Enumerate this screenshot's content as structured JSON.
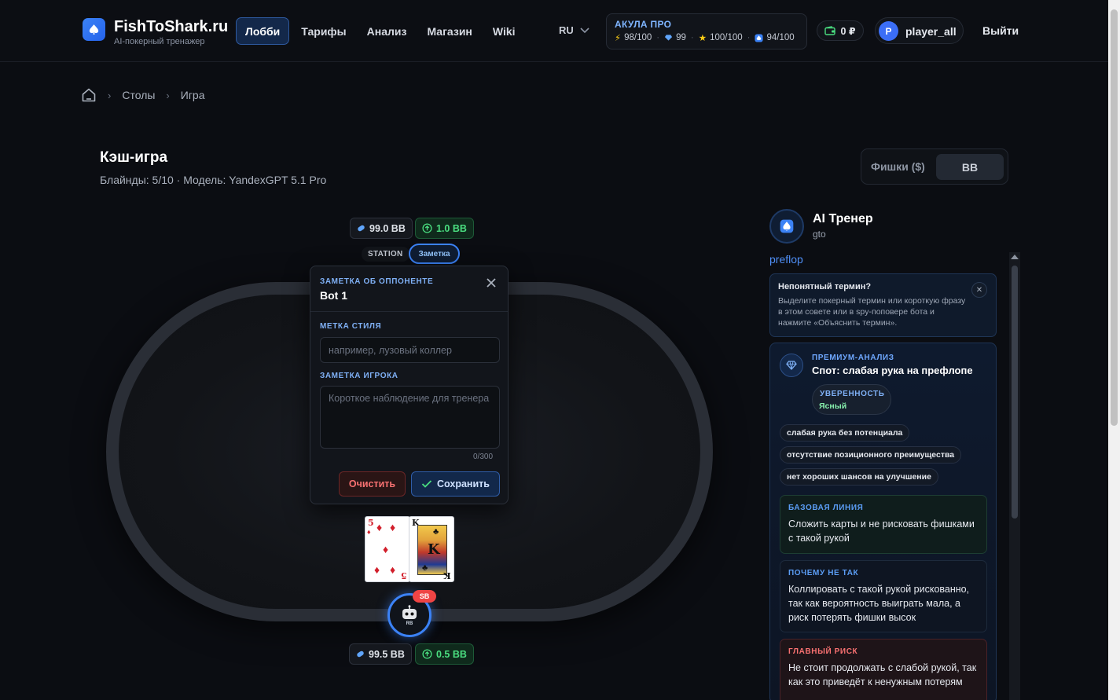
{
  "header": {
    "brand": "FishToShark.ru",
    "brand_sub": "AI-покерный тренажер",
    "nav": [
      {
        "label": "Лобби",
        "active": true
      },
      {
        "label": "Тарифы"
      },
      {
        "label": "Анализ"
      },
      {
        "label": "Магазин"
      },
      {
        "label": "Wiki"
      }
    ],
    "language": "RU",
    "plan": {
      "title": "АКУЛА ПРО",
      "stat1": "98/100",
      "stat2": "99",
      "stat3": "100/100",
      "stat4": "94/100"
    },
    "wallet": "0 ₽",
    "avatar_letter": "P",
    "username": "player_all",
    "logout": "Выйти"
  },
  "breadcrumb": {
    "items": [
      "Столы",
      "Игра"
    ]
  },
  "page": {
    "title": "Кэш-игра",
    "subtitle": "Блайнды: 5/10 · Модель: YandexGPT 5.1 Pro",
    "toggle_chips": "Фишки ($)",
    "toggle_bb": "BB"
  },
  "table": {
    "top_player": {
      "stack": "99.0 BB",
      "bet": "1.0 BB",
      "style_tag": "STATION",
      "note_button": "Заметка"
    },
    "hero": {
      "stack": "99.5 BB",
      "bet": "0.5 BB",
      "position": "SB",
      "avatar_label": "RB",
      "cards": [
        {
          "rank": "5",
          "suit": "♦"
        },
        {
          "rank": "K",
          "suit": "♣"
        }
      ]
    }
  },
  "note_popup": {
    "kicker": "ЗАМЕТКА ОБ ОППОНЕНТЕ",
    "title": "Bot 1",
    "style_label": "МЕТКА СТИЛЯ",
    "style_placeholder": "например, лузовый коллер",
    "note_label": "ЗАМЕТКА ИГРОКА",
    "note_placeholder": "Короткое наблюдение для тренера",
    "counter": "0/300",
    "clear_button": "Очистить",
    "save_button": "Сохранить"
  },
  "coach": {
    "title": "AI Тренер",
    "mode": "gto",
    "street": "preflop",
    "hint": {
      "title": "Непонятный термин?",
      "text": "Выделите покерный термин или короткую фразу в этом совете или в spy-поповере бота и нажмите «Объяснить термин»."
    },
    "premium": {
      "kicker": "ПРЕМИУМ-АНАЛИЗ",
      "title": "Спот: слабая рука на префлопе",
      "confidence_label": "УВЕРЕННОСТЬ",
      "confidence_value": "Ясный",
      "tags": [
        "слабая рука без потенциала",
        "отсутствие позиционного преимущества",
        "нет хороших шансов на улучшение"
      ],
      "baseline_label": "БАЗОВАЯ ЛИНИЯ",
      "baseline_text": "Сложить карты и не рисковать фишками с такой рукой",
      "why_not_label": "ПОЧЕМУ НЕ ТАК",
      "why_not_text": "Коллировать с такой рукой рискованно, так как вероятность выиграть мала, а риск потерять фишки высок",
      "risk_label": "ГЛАВНЫЙ РИСК",
      "risk_text": "Не стоит продолжать с слабой рукой, так как это приведёт к ненужным потерям"
    }
  },
  "colors": {
    "accent": "#3b82f6",
    "bet_green": "#4ade80",
    "danger": "#ef4444"
  }
}
